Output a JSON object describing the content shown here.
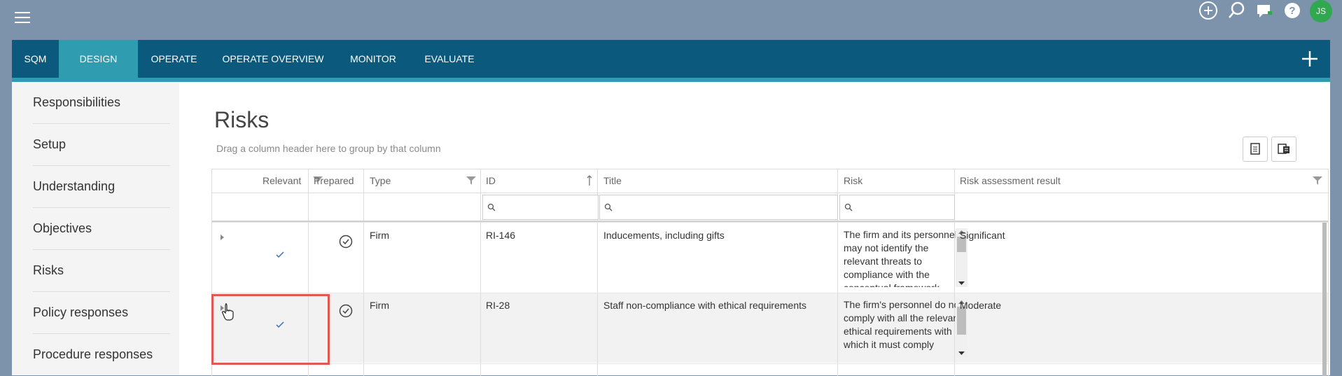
{
  "topbar": {
    "avatar_initials": "JS"
  },
  "nav": {
    "tabs": [
      {
        "label": "SQM"
      },
      {
        "label": "DESIGN",
        "active": true
      },
      {
        "label": "OPERATE"
      },
      {
        "label": "OPERATE OVERVIEW"
      },
      {
        "label": "MONITOR"
      },
      {
        "label": "EVALUATE"
      }
    ]
  },
  "sidebar": {
    "items": [
      {
        "label": "Responsibilities"
      },
      {
        "label": "Setup"
      },
      {
        "label": "Understanding"
      },
      {
        "label": "Objectives"
      },
      {
        "label": "Risks"
      },
      {
        "label": "Policy responses"
      },
      {
        "label": "Procedure responses"
      }
    ]
  },
  "page": {
    "title": "Risks",
    "group_hint": "Drag a column header here to group by that column"
  },
  "grid": {
    "columns": [
      {
        "label": "Relevant"
      },
      {
        "label": "Prepared"
      },
      {
        "label": "Type"
      },
      {
        "label": "ID"
      },
      {
        "label": "Title"
      },
      {
        "label": "Risk"
      },
      {
        "label": "Risk assessment result"
      }
    ],
    "rows": [
      {
        "type": "Firm",
        "id": "RI-146",
        "title": "Inducements, including gifts",
        "risk": "The firm and its personnel may not identify the relevant threats to compliance with the conceptual framework",
        "result": "Significant"
      },
      {
        "type": "Firm",
        "id": "RI-28",
        "title": "Staff non-compliance with ethical requirements",
        "risk": "The firm's personnel do not comply with all the relevant ethical requirements with which it must comply",
        "result": "Moderate"
      }
    ]
  },
  "colors": {
    "nav_bg": "#0b5a7e",
    "accent": "#2f9cb0",
    "highlight": "#e0584f",
    "avatar": "#2fa84f"
  }
}
